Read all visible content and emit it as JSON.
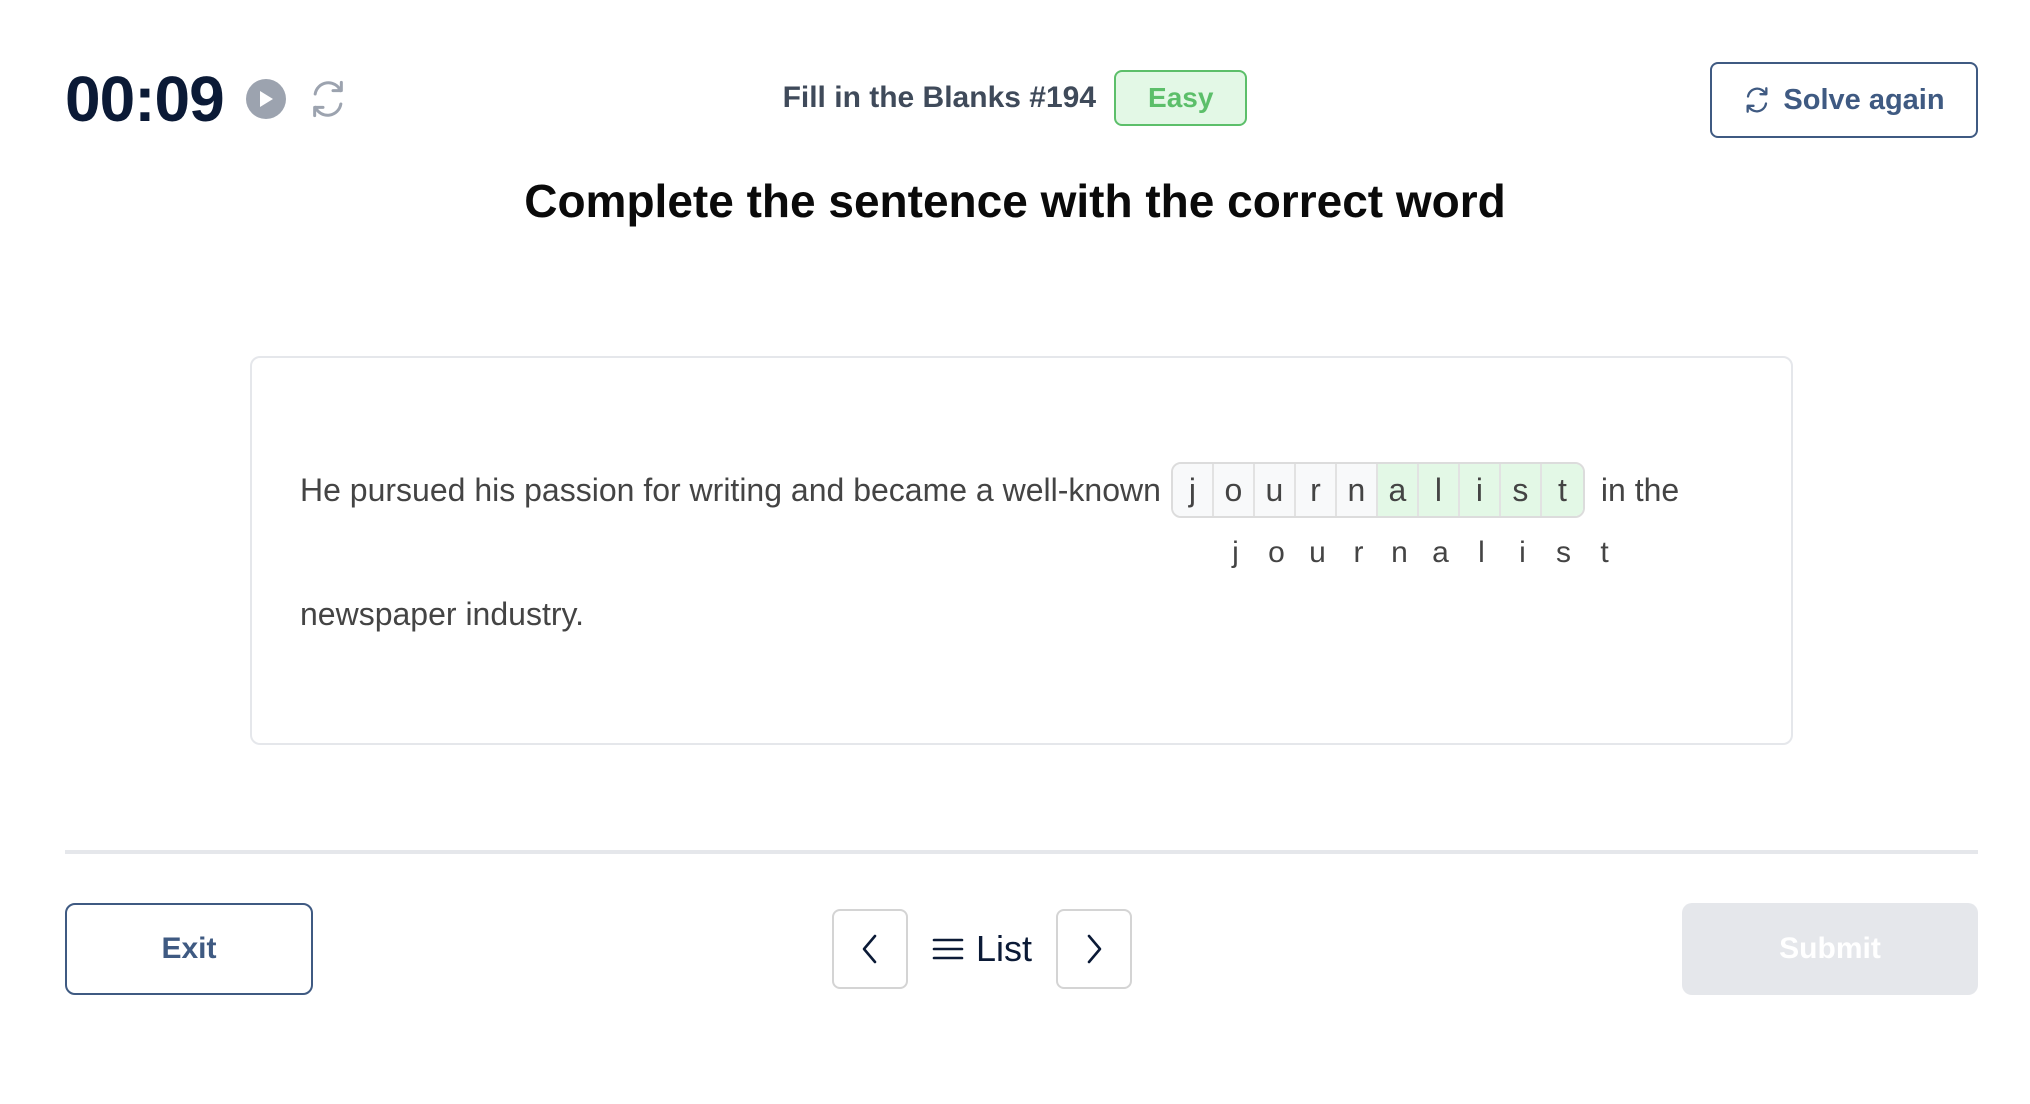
{
  "timer": {
    "value": "00:09",
    "play_icon": "play-icon",
    "reset_icon": "refresh-icon"
  },
  "header": {
    "puzzle_title": "Fill in the Blanks #194",
    "difficulty": "Easy",
    "solve_again_label": "Solve again",
    "colors": {
      "difficulty_text": "#5cbf6a",
      "difficulty_bg": "#e3f8e6",
      "primary": "#3f5a82"
    }
  },
  "prompt": "Complete the sentence with the correct word",
  "sentence": {
    "before": "He pursued his passion for writing and became a well-known",
    "after_inline": "in the",
    "continuation": "newspaper industry.",
    "answer_cells": [
      {
        "letter": "j",
        "state": "given"
      },
      {
        "letter": "o",
        "state": "given"
      },
      {
        "letter": "u",
        "state": "given"
      },
      {
        "letter": "r",
        "state": "given"
      },
      {
        "letter": "n",
        "state": "given"
      },
      {
        "letter": "a",
        "state": "filled"
      },
      {
        "letter": "l",
        "state": "filled"
      },
      {
        "letter": "i",
        "state": "filled"
      },
      {
        "letter": "s",
        "state": "filled"
      },
      {
        "letter": "t",
        "state": "filled"
      }
    ],
    "hint_letters": [
      "j",
      "o",
      "u",
      "r",
      "n",
      "a",
      "l",
      "i",
      "s",
      "t"
    ]
  },
  "footer": {
    "exit_label": "Exit",
    "list_label": "List",
    "submit_label": "Submit",
    "submit_enabled": false
  }
}
